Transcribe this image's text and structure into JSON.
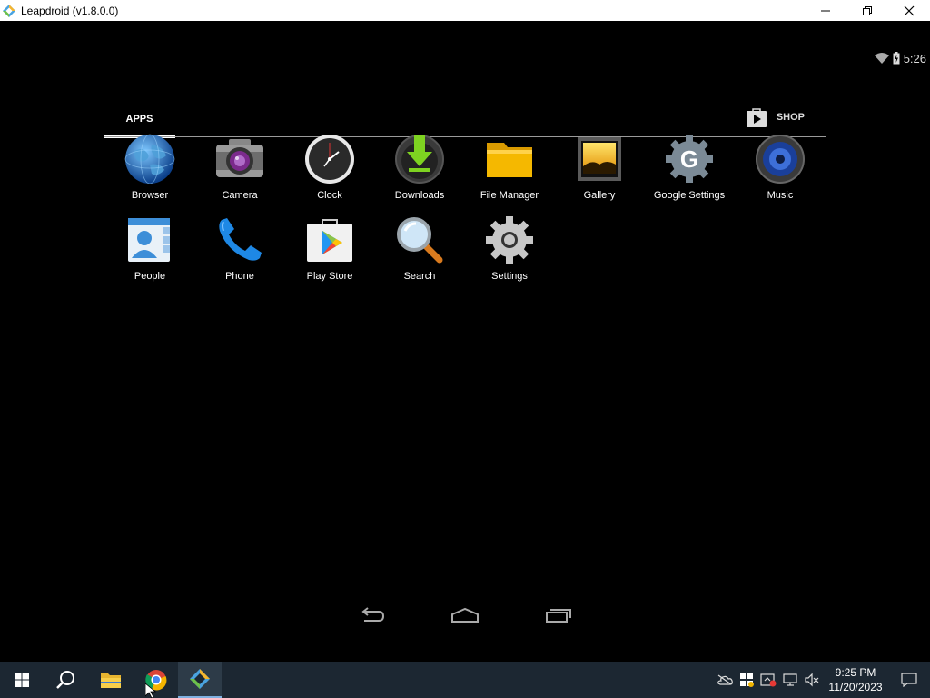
{
  "window": {
    "title": "Leapdroid (v1.8.0.0)",
    "controls": [
      "minimize",
      "restore",
      "close"
    ]
  },
  "android": {
    "status": {
      "time": "5:26",
      "icons": [
        "wifi-icon",
        "battery-icon"
      ]
    },
    "tabs": {
      "apps_label": "APPS",
      "shop_label": "SHOP"
    },
    "apps": [
      {
        "label": "Browser",
        "icon": "globe-icon"
      },
      {
        "label": "Camera",
        "icon": "camera-icon"
      },
      {
        "label": "Clock",
        "icon": "clock-icon"
      },
      {
        "label": "Downloads",
        "icon": "download-icon"
      },
      {
        "label": "File Manager",
        "icon": "folder-icon"
      },
      {
        "label": "Gallery",
        "icon": "gallery-icon"
      },
      {
        "label": "Google Settings",
        "icon": "google-settings-icon"
      },
      {
        "label": "Music",
        "icon": "speaker-icon"
      },
      {
        "label": "People",
        "icon": "contacts-icon"
      },
      {
        "label": "Phone",
        "icon": "phone-icon"
      },
      {
        "label": "Play Store",
        "icon": "play-store-icon"
      },
      {
        "label": "Search",
        "icon": "magnifier-icon"
      },
      {
        "label": "Settings",
        "icon": "gear-icon"
      }
    ],
    "navbar": [
      "back-icon",
      "home-icon",
      "recents-icon"
    ]
  },
  "taskbar": {
    "items": [
      "windows-start-icon",
      "search-icon",
      "file-explorer-icon",
      "chrome-icon",
      "leapdroid-icon"
    ],
    "tray_icons": [
      "onedrive-icon",
      "defender-icon",
      "security-icon",
      "network-icon",
      "volume-muted-icon"
    ],
    "time": "9:25 PM",
    "date": "11/20/2023"
  },
  "colors": {
    "taskbar_bg": "#1c2732",
    "screen_bg": "#000000",
    "accent": "#7fb0e0"
  }
}
